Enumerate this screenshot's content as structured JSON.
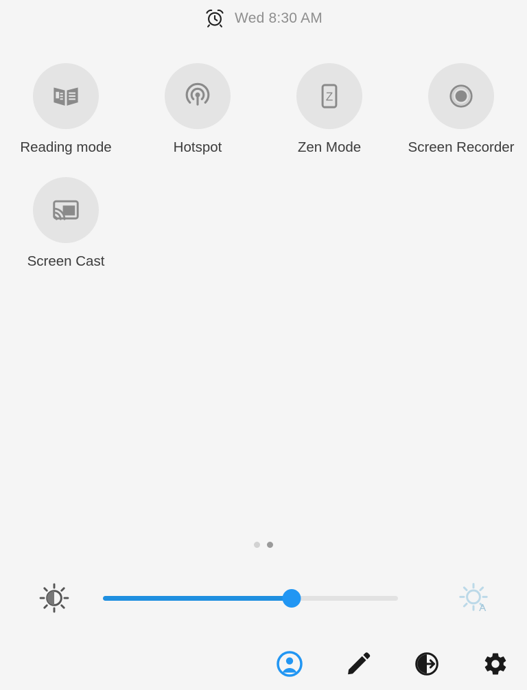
{
  "status_bar": {
    "alarm_icon": "alarm-clock-icon",
    "clock_text": "Wed 8:30 AM"
  },
  "tiles": [
    {
      "label": "Reading mode",
      "icon": "book-icon",
      "state": "off"
    },
    {
      "label": "Hotspot",
      "icon": "hotspot-icon",
      "state": "off"
    },
    {
      "label": "Zen Mode",
      "icon": "zen-mode-icon",
      "state": "off"
    },
    {
      "label": "Screen Recorder",
      "icon": "screen-recorder-icon",
      "state": "off"
    },
    {
      "label": "Screen Cast",
      "icon": "screen-cast-icon",
      "state": "off"
    }
  ],
  "page_indicator": {
    "total": 2,
    "active_index": 1
  },
  "brightness": {
    "left_icon": "brightness-contrast-icon",
    "right_icon": "auto-brightness-icon",
    "value_percent": 64,
    "fill_color": "#1f8fe0",
    "thumb_color": "#2196f3",
    "track_color": "#e2e2e2",
    "auto_icon_color": "#bcd9e8"
  },
  "bottom_bar": [
    {
      "name": "user-account-button",
      "icon": "user-account-icon",
      "color": "#2196f3"
    },
    {
      "name": "edit-button",
      "icon": "pencil-icon",
      "color": "#1a1a1a"
    },
    {
      "name": "power-button",
      "icon": "power-circle-icon",
      "color": "#1a1a1a"
    },
    {
      "name": "settings-button",
      "icon": "gear-icon",
      "color": "#1a1a1a"
    }
  ],
  "theme": {
    "background": "#f5f5f5",
    "tile_circle": "#e4e4e4",
    "icon_grey": "#8a8a8a",
    "label_color": "#3c3c3c",
    "clock_color": "#8e8e8e"
  }
}
